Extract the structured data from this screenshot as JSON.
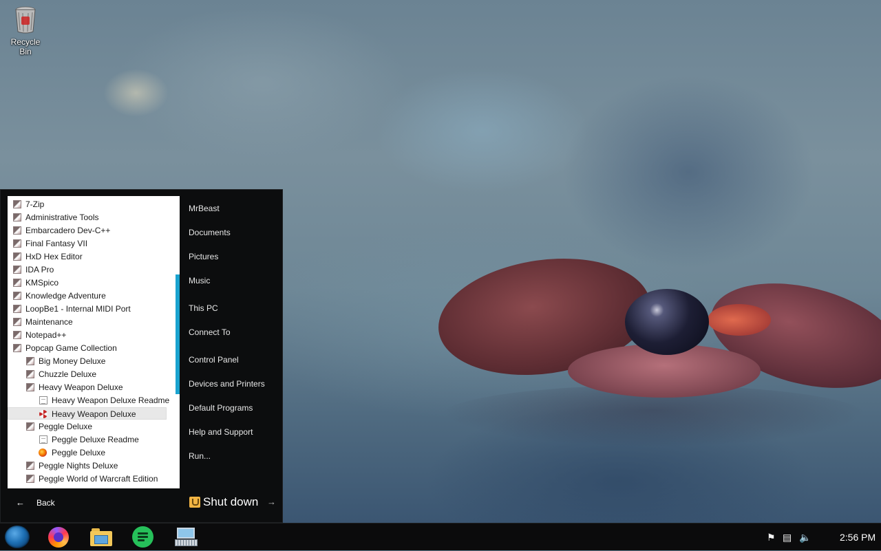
{
  "desktop": {
    "icons": [
      {
        "label": "Recycle Bin",
        "icon": "recycle-bin-icon"
      }
    ]
  },
  "start_menu": {
    "programs": [
      {
        "label": "7-Zip",
        "icon": "folder",
        "indent": 0
      },
      {
        "label": "Administrative Tools",
        "icon": "folder",
        "indent": 0
      },
      {
        "label": "Embarcadero Dev-C++",
        "icon": "folder",
        "indent": 0
      },
      {
        "label": "Final Fantasy VII",
        "icon": "folder",
        "indent": 0
      },
      {
        "label": "HxD Hex Editor",
        "icon": "folder",
        "indent": 0
      },
      {
        "label": "IDA Pro",
        "icon": "folder",
        "indent": 0
      },
      {
        "label": "KMSpico",
        "icon": "folder",
        "indent": 0
      },
      {
        "label": "Knowledge Adventure",
        "icon": "folder",
        "indent": 0
      },
      {
        "label": "LoopBe1 - Internal MIDI Port",
        "icon": "folder",
        "indent": 0
      },
      {
        "label": "Maintenance",
        "icon": "folder",
        "indent": 0
      },
      {
        "label": "Notepad++",
        "icon": "folder",
        "indent": 0
      },
      {
        "label": "Popcap Game Collection",
        "icon": "folder",
        "indent": 0
      },
      {
        "label": "Big Money Deluxe",
        "icon": "folder",
        "indent": 1
      },
      {
        "label": "Chuzzle Deluxe",
        "icon": "folder",
        "indent": 1
      },
      {
        "label": "Heavy Weapon Deluxe",
        "icon": "folder",
        "indent": 1
      },
      {
        "label": "Heavy Weapon Deluxe Readme",
        "icon": "document",
        "indent": 2
      },
      {
        "label": "Heavy Weapon Deluxe",
        "icon": "radiation",
        "indent": 2,
        "selected": true
      },
      {
        "label": "Peggle Deluxe",
        "icon": "folder",
        "indent": 1
      },
      {
        "label": "Peggle Deluxe Readme",
        "icon": "document",
        "indent": 2
      },
      {
        "label": "Peggle Deluxe",
        "icon": "peggle",
        "indent": 2
      },
      {
        "label": "Peggle Nights Deluxe",
        "icon": "folder",
        "indent": 1
      },
      {
        "label": "Peggle World of Warcraft Edition",
        "icon": "folder",
        "indent": 1
      }
    ],
    "places": [
      "MrBeast",
      "Documents",
      "Pictures",
      "Music",
      "This PC",
      "Connect To",
      "Control Panel",
      "Devices and Printers",
      "Default Programs",
      "Help and Support",
      "Run..."
    ],
    "back_label": "Back",
    "shutdown_label": "Shut down"
  },
  "taskbar": {
    "apps": [
      "start-orb",
      "firefox",
      "file-explorer",
      "notes",
      "on-screen-keyboard"
    ],
    "tray_icons": [
      "flag-icon",
      "network-icon",
      "volume-icon"
    ],
    "clock": "2:56 PM"
  },
  "colors": {
    "scroll_accent": "#1aa3cf",
    "menu_bg": "#0c0d0e"
  }
}
